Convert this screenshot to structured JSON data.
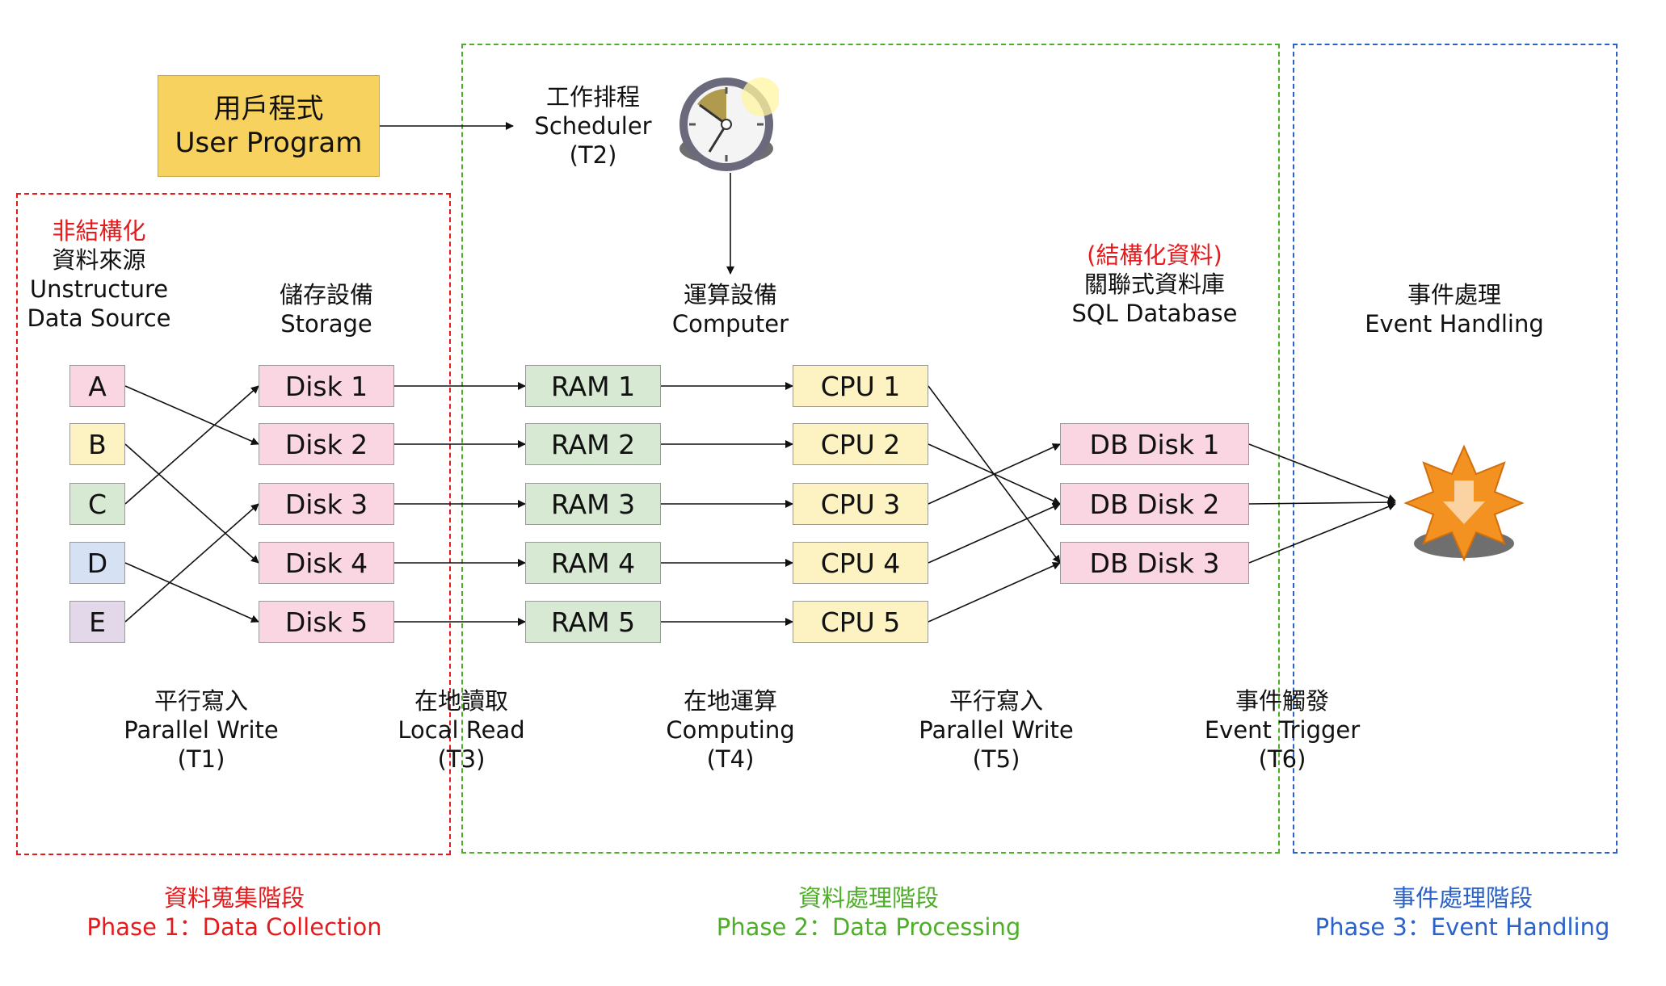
{
  "colors": {
    "phase1": "#e41a1c",
    "phase2": "#4caf27",
    "phase3": "#2a62c9",
    "pink": "#f9d6e1",
    "yellow": "#fdf2c2",
    "green": "#d7e8d3",
    "blue": "#d6e2f4",
    "purple": "#e2d8ea",
    "program": "#f8d25e"
  },
  "user_program": {
    "zh": "用戶程式",
    "en": "User Program"
  },
  "scheduler": {
    "zh": "工作排程",
    "en": "Scheduler",
    "tag": "(T2)",
    "icon": "clock-icon"
  },
  "source_header": {
    "zh_red": "非結構化",
    "zh": "資料來源",
    "en1": "Unstructure",
    "en2": "Data Source"
  },
  "storage_header": {
    "zh": "儲存設備",
    "en": "Storage"
  },
  "computer_header": {
    "zh": "運算設備",
    "en": "Computer"
  },
  "db_header": {
    "zh_red": "(結構化資料)",
    "zh": "關聯式資料庫",
    "en": "SQL Database"
  },
  "event_header": {
    "zh": "事件處理",
    "en": "Event Handling",
    "icon": "event-burst-icon"
  },
  "sources": [
    "A",
    "B",
    "C",
    "D",
    "E"
  ],
  "disks": [
    "Disk 1",
    "Disk 2",
    "Disk 3",
    "Disk 4",
    "Disk 5"
  ],
  "rams": [
    "RAM 1",
    "RAM 2",
    "RAM 3",
    "RAM 4",
    "RAM 5"
  ],
  "cpus": [
    "CPU 1",
    "CPU 2",
    "CPU 3",
    "CPU 4",
    "CPU 5"
  ],
  "db_disks": [
    "DB Disk 1",
    "DB Disk 2",
    "DB Disk 3"
  ],
  "steps": [
    {
      "zh": "平行寫入",
      "en": "Parallel Write",
      "tag": "(T1)"
    },
    {
      "zh": "在地讀取",
      "en": "Local Read",
      "tag": "(T3)"
    },
    {
      "zh": "在地運算",
      "en": "Computing",
      "tag": "(T4)"
    },
    {
      "zh": "平行寫入",
      "en": "Parallel Write",
      "tag": "(T5)"
    },
    {
      "zh": "事件觸發",
      "en": "Event Trigger",
      "tag": "(T6)"
    }
  ],
  "phases": [
    {
      "zh": "資料蒐集階段",
      "en": "Phase 1：Data Collection"
    },
    {
      "zh": "資料處理階段",
      "en": "Phase 2：Data Processing"
    },
    {
      "zh": "事件處理階段",
      "en": "Phase 3：Event Handling"
    }
  ]
}
